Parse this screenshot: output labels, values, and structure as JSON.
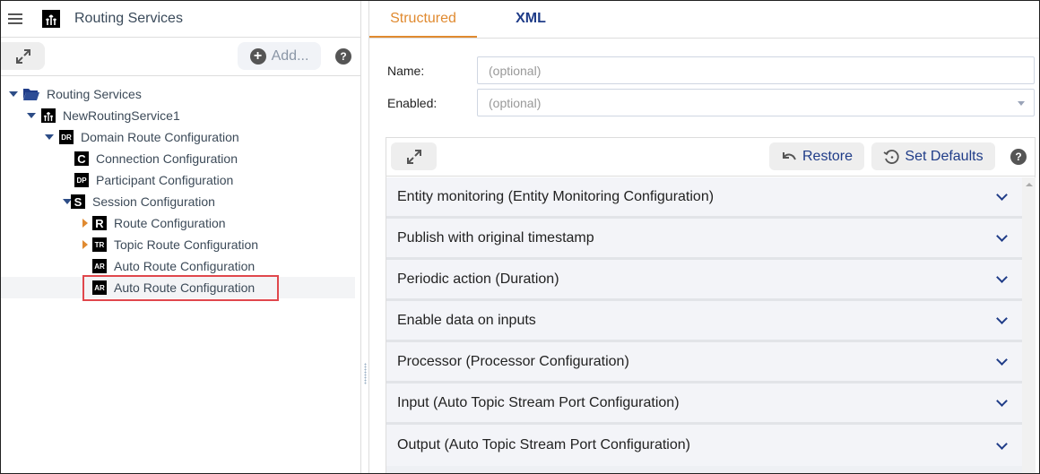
{
  "header": {
    "app_title": "Routing Services",
    "menu_icon": "hamburger-menu-icon",
    "logo_icon": "routing-service-icon"
  },
  "left_toolbar": {
    "expand_icon": "expand-arrows-icon",
    "add_label": "Add...",
    "add_icon": "plus-circle-icon",
    "help_label": "?"
  },
  "tree": [
    {
      "label": "Routing Services",
      "icon": "folder-open-icon",
      "badge": "",
      "expanded": true,
      "level": 0
    },
    {
      "label": "NewRoutingService1",
      "icon": "routing-service-icon",
      "badge": "",
      "expanded": true,
      "level": 1
    },
    {
      "label": "Domain Route Configuration",
      "icon": "badge-icon",
      "badge": "DR",
      "expanded": true,
      "level": 2
    },
    {
      "label": "Connection Configuration",
      "icon": "badge-icon",
      "badge": "C",
      "level": 3
    },
    {
      "label": "Participant Configuration",
      "icon": "badge-icon",
      "badge": "DP",
      "level": 3
    },
    {
      "label": "Session Configuration",
      "icon": "badge-icon",
      "badge": "S",
      "expanded": true,
      "level": 3
    },
    {
      "label": "Route Configuration",
      "icon": "badge-icon",
      "badge": "R",
      "collapsed": true,
      "level": 4
    },
    {
      "label": "Topic Route Configuration",
      "icon": "badge-icon",
      "badge": "TR",
      "collapsed": true,
      "level": 4
    },
    {
      "label": "Auto Route Configuration",
      "icon": "badge-icon",
      "badge": "AR",
      "level": 4
    },
    {
      "label": "Auto Route Configuration",
      "icon": "badge-icon",
      "badge": "AR",
      "level": 4,
      "selected": true
    }
  ],
  "tabs": [
    {
      "label": "Structured",
      "active": true
    },
    {
      "label": "XML",
      "active": false
    }
  ],
  "form": {
    "name_label": "Name:",
    "name_value": "",
    "name_placeholder": "(optional)",
    "enabled_label": "Enabled:",
    "enabled_value": "",
    "enabled_placeholder": "(optional)"
  },
  "panel_toolbar": {
    "expand_icon": "expand-arrows-icon",
    "restore_label": "Restore",
    "restore_icon": "undo-icon",
    "set_defaults_label": "Set Defaults",
    "set_defaults_icon": "history-icon",
    "help_label": "?"
  },
  "sections": [
    {
      "label": "Entity monitoring (Entity Monitoring Configuration)"
    },
    {
      "label": "Publish with original timestamp"
    },
    {
      "label": "Periodic action (Duration)"
    },
    {
      "label": "Enable data on inputs"
    },
    {
      "label": "Processor (Processor Configuration)"
    },
    {
      "label": "Input (Auto Topic Stream Port Configuration)"
    },
    {
      "label": "Output (Auto Topic Stream Port Configuration)"
    }
  ],
  "colors": {
    "accent": "#e08a30",
    "link": "#1f3c88",
    "selection_border": "#e0474c"
  }
}
